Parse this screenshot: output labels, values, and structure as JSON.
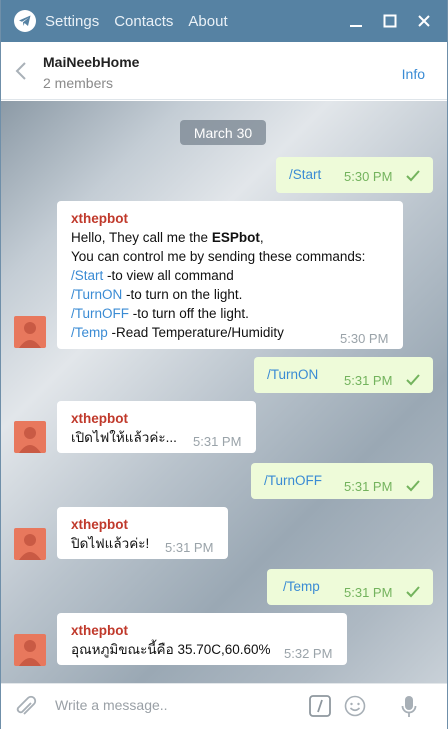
{
  "menu": {
    "settings": "Settings",
    "contacts": "Contacts",
    "about": "About"
  },
  "chat": {
    "title": "MaiNeebHome",
    "subtitle": "2 members",
    "info": "Info"
  },
  "date_label": "March 30",
  "messages": [
    {
      "dir": "out",
      "text": "/Start",
      "time": "5:30 PM"
    },
    {
      "dir": "in",
      "sender": "xthepbot",
      "time": "5:30 PM",
      "l1": "Hello, They call me the ",
      "l1b": "ESPbot",
      "l1c": ",",
      "l2": "You can control me by sending these commands:",
      "l3cmd": "/Start",
      "l3": " -to view all command",
      "l4cmd": "/TurnON",
      "l4": " -to turn on the light.",
      "l5cmd": "/TurnOFF",
      "l5": " -to turn off the light.",
      "l6cmd": "/Temp",
      "l6": " -Read Temperature/Humidity"
    },
    {
      "dir": "out",
      "text": "/TurnON",
      "time": "5:31 PM"
    },
    {
      "dir": "in",
      "sender": "xthepbot",
      "text": "เปิดไฟให้แล้วค่ะ...",
      "time": "5:31 PM"
    },
    {
      "dir": "out",
      "text": "/TurnOFF",
      "time": "5:31 PM"
    },
    {
      "dir": "in",
      "sender": "xthepbot",
      "text": "ปิดไฟแล้วค่ะ!",
      "time": "5:31 PM"
    },
    {
      "dir": "out",
      "text": "/Temp",
      "time": "5:31 PM"
    },
    {
      "dir": "in",
      "sender": "xthepbot",
      "text": "อุณหภูมิขณะนี้คือ 35.70C,60.60%",
      "time": "5:32 PM"
    }
  ],
  "compose": {
    "placeholder": "Write a message.."
  },
  "colors": {
    "titlebar": "#5682a3",
    "outgoing": "#eefbd9",
    "link": "#3a8bd4",
    "sender": "#c0392b",
    "avatar": "#e8785d"
  }
}
